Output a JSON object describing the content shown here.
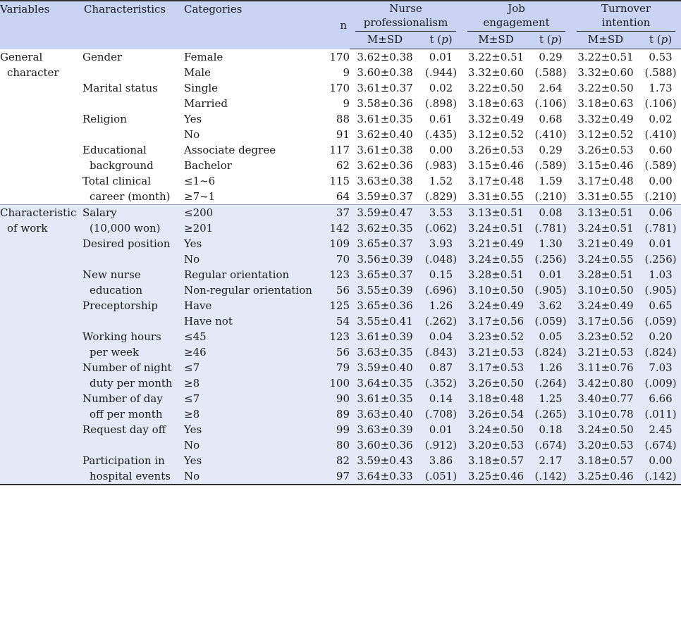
{
  "header": {
    "variables": "Variables",
    "characteristics": "Characteristics",
    "categories": "Categories",
    "n": "n",
    "groups": [
      {
        "l1": "Nurse",
        "l2": "professionalism"
      },
      {
        "l1": "Job",
        "l2": "engagement"
      },
      {
        "l1": "Turnover",
        "l2": "intention"
      }
    ],
    "msd": "M±SD",
    "t": "t (",
    "p": "p",
    "close": ")"
  },
  "rows": [
    {
      "var": [
        "General",
        "character"
      ],
      "chars": [
        "Gender"
      ],
      "cats": [
        "Female",
        "Male"
      ],
      "n": [
        "170",
        "9"
      ],
      "np_m": [
        "3.62±0.38",
        "3.60±0.38"
      ],
      "np_t": [
        "0.01",
        "(.944)"
      ],
      "je_m": [
        "3.22±0.51",
        "3.32±0.60"
      ],
      "je_t": [
        "0.29",
        "(.588)"
      ],
      "ti_m": [
        "3.22±0.51",
        "3.32±0.60"
      ],
      "ti_t": [
        "0.53",
        "(.588)"
      ]
    },
    {
      "var": [],
      "chars": [
        "Marital status"
      ],
      "cats": [
        "Single",
        "Married"
      ],
      "n": [
        "170",
        "9"
      ],
      "np_m": [
        "3.61±0.37",
        "3.58±0.36"
      ],
      "np_t": [
        "0.02",
        "(.898)"
      ],
      "je_m": [
        "3.22±0.50",
        "3.18±0.63"
      ],
      "je_t": [
        "2.64",
        "(.106)"
      ],
      "ti_m": [
        "3.22±0.50",
        "3.18±0.63"
      ],
      "ti_t": [
        "1.73",
        "(.106)"
      ]
    },
    {
      "var": [],
      "chars": [
        "Religion"
      ],
      "cats": [
        "Yes",
        "No"
      ],
      "n": [
        "88",
        "91"
      ],
      "np_m": [
        "3.61±0.35",
        "3.62±0.40"
      ],
      "np_t": [
        "0.61",
        "(.435)"
      ],
      "je_m": [
        "3.32±0.49",
        "3.12±0.52"
      ],
      "je_t": [
        "0.68",
        "(.410)"
      ],
      "ti_m": [
        "3.32±0.49",
        "3.12±0.52"
      ],
      "ti_t": [
        "0.02",
        "(.410)"
      ]
    },
    {
      "var": [],
      "chars": [
        "Educational",
        "background"
      ],
      "cats": [
        "Associate degree",
        "Bachelor"
      ],
      "n": [
        "117",
        "62"
      ],
      "np_m": [
        "3.61±0.38",
        "3.62±0.36"
      ],
      "np_t": [
        "0.00",
        "(.983)"
      ],
      "je_m": [
        "3.26±0.53",
        "3.15±0.46"
      ],
      "je_t": [
        "0.29",
        "(.589)"
      ],
      "ti_m": [
        "3.26±0.53",
        "3.15±0.46"
      ],
      "ti_t": [
        "0.60",
        "(.589)"
      ]
    },
    {
      "var": [],
      "chars": [
        "Total clinical",
        "career (month)"
      ],
      "cats": [
        "≤1~6",
        "≥7~1"
      ],
      "n": [
        "115",
        "64"
      ],
      "np_m": [
        "3.63±0.38",
        "3.59±0.37"
      ],
      "np_t": [
        "1.52",
        "(.829)"
      ],
      "je_m": [
        "3.17±0.48",
        "3.31±0.55"
      ],
      "je_t": [
        "1.59",
        "(.210)"
      ],
      "ti_m": [
        "3.17±0.48",
        "3.31±0.55"
      ],
      "ti_t": [
        "0.00",
        "(.210)"
      ]
    },
    {
      "var": [
        "Characteristic",
        "of work"
      ],
      "chars": [
        "Salary",
        "(10,000 won)"
      ],
      "cats": [
        "≤200",
        "≥201"
      ],
      "n": [
        "37",
        "142"
      ],
      "np_m": [
        "3.59±0.47",
        "3.62±0.35"
      ],
      "np_t": [
        "3.53",
        "(.062)"
      ],
      "je_m": [
        "3.13±0.51",
        "3.24±0.51"
      ],
      "je_t": [
        "0.08",
        "(.781)"
      ],
      "ti_m": [
        "3.13±0.51",
        "3.24±0.51"
      ],
      "ti_t": [
        "0.06",
        "(.781)"
      ]
    },
    {
      "var": [],
      "chars": [
        "Desired position"
      ],
      "cats": [
        "Yes",
        "No"
      ],
      "n": [
        "109",
        "70"
      ],
      "np_m": [
        "3.65±0.37",
        "3.56±0.39"
      ],
      "np_t": [
        "3.93",
        "(.048)"
      ],
      "je_m": [
        "3.21±0.49",
        "3.24±0.55"
      ],
      "je_t": [
        "1.30",
        "(.256)"
      ],
      "ti_m": [
        "3.21±0.49",
        "3.24±0.55"
      ],
      "ti_t": [
        "0.01",
        "(.256)"
      ]
    },
    {
      "var": [],
      "chars": [
        "New nurse",
        "education"
      ],
      "cats": [
        "Regular orientation",
        "Non-regular orientation"
      ],
      "n": [
        "123",
        "56"
      ],
      "np_m": [
        "3.65±0.37",
        "3.55±0.39"
      ],
      "np_t": [
        "0.15",
        "(.696)"
      ],
      "je_m": [
        "3.28±0.51",
        "3.10±0.50"
      ],
      "je_t": [
        "0.01",
        "(.905)"
      ],
      "ti_m": [
        "3.28±0.51",
        "3.10±0.50"
      ],
      "ti_t": [
        "1.03",
        "(.905)"
      ]
    },
    {
      "var": [],
      "chars": [
        "Preceptorship"
      ],
      "cats": [
        "Have",
        "Have not"
      ],
      "n": [
        "125",
        "54"
      ],
      "np_m": [
        "3.65±0.36",
        "3.55±0.41"
      ],
      "np_t": [
        "1.26",
        "(.262)"
      ],
      "je_m": [
        "3.24±0.49",
        "3.17±0.56"
      ],
      "je_t": [
        "3.62",
        "(.059)"
      ],
      "ti_m": [
        "3.24±0.49",
        "3.17±0.56"
      ],
      "ti_t": [
        "0.65",
        "(.059)"
      ]
    },
    {
      "var": [],
      "chars": [
        "Working hours",
        "per week"
      ],
      "cats": [
        "≤45",
        "≥46"
      ],
      "n": [
        "123",
        "56"
      ],
      "np_m": [
        "3.61±0.39",
        "3.63±0.35"
      ],
      "np_t": [
        "0.04",
        "(.843)"
      ],
      "je_m": [
        "3.23±0.52",
        "3.21±0.53"
      ],
      "je_t": [
        "0.05",
        "(.824)"
      ],
      "ti_m": [
        "3.23±0.52",
        "3.21±0.53"
      ],
      "ti_t": [
        "0.20",
        "(.824)"
      ]
    },
    {
      "var": [],
      "chars": [
        "Number of night",
        "duty per month"
      ],
      "cats": [
        "≤7",
        "≥8"
      ],
      "n": [
        "79",
        "100"
      ],
      "np_m": [
        "3.59±0.40",
        "3.64±0.35"
      ],
      "np_t": [
        "0.87",
        "(.352)"
      ],
      "je_m": [
        "3.17±0.53",
        "3.26±0.50"
      ],
      "je_t": [
        "1.26",
        "(.264)"
      ],
      "ti_m": [
        "3.11±0.76",
        "3.42±0.80"
      ],
      "ti_t": [
        "7.03",
        "(.009)"
      ]
    },
    {
      "var": [],
      "chars": [
        "Number of day",
        "off per month"
      ],
      "cats": [
        "≤7",
        "≥8"
      ],
      "n": [
        "90",
        "89"
      ],
      "np_m": [
        "3.61±0.35",
        "3.63±0.40"
      ],
      "np_t": [
        "0.14",
        "(.708)"
      ],
      "je_m": [
        "3.18±0.48",
        "3.26±0.54"
      ],
      "je_t": [
        "1.25",
        "(.265)"
      ],
      "ti_m": [
        "3.40±0.77",
        "3.10±0.78"
      ],
      "ti_t": [
        "6.66",
        "(.011)"
      ]
    },
    {
      "var": [],
      "chars": [
        "Request day off"
      ],
      "cats": [
        "Yes",
        "No"
      ],
      "n": [
        "99",
        "80"
      ],
      "np_m": [
        "3.63±0.39",
        "3.60±0.36"
      ],
      "np_t": [
        "0.01",
        "(.912)"
      ],
      "je_m": [
        "3.24±0.50",
        "3.20±0.53"
      ],
      "je_t": [
        "0.18",
        "(.674)"
      ],
      "ti_m": [
        "3.24±0.50",
        "3.20±0.53"
      ],
      "ti_t": [
        "2.45",
        "(.674)"
      ]
    },
    {
      "var": [],
      "chars": [
        "Participation in",
        "hospital events"
      ],
      "cats": [
        "Yes",
        "No"
      ],
      "n": [
        "82",
        "97"
      ],
      "np_m": [
        "3.59±0.43",
        "3.64±0.33"
      ],
      "np_t": [
        "3.86",
        "(.051)"
      ],
      "je_m": [
        "3.18±0.57",
        "3.25±0.46"
      ],
      "je_t": [
        "2.17",
        "(.142)"
      ],
      "ti_m": [
        "3.18±0.57",
        "3.25±0.46"
      ],
      "ti_t": [
        "0.00",
        "(.142)"
      ]
    }
  ]
}
